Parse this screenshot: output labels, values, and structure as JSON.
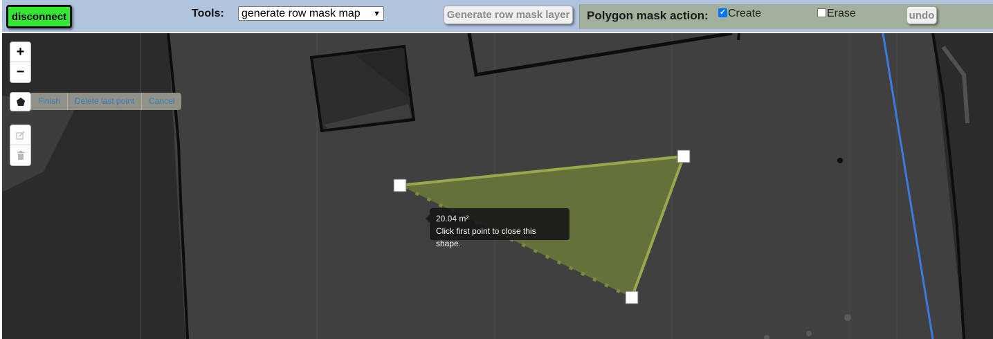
{
  "toolbar": {
    "disconnect_label": "disconnect",
    "tools_label": "Tools:",
    "tools_selected": "generate row mask map",
    "generate_button": "Generate row mask layer",
    "polygon_action_label": "Polygon mask action:",
    "create_label": "Create",
    "create_checked": true,
    "erase_label": "Erase",
    "erase_checked": false,
    "undo_label": "undo"
  },
  "map_controls": {
    "zoom_in": "+",
    "zoom_out": "−",
    "draw_actions": [
      "Finish",
      "Delete last point",
      "Cancel"
    ]
  },
  "drawing": {
    "area": "20.04 m²",
    "hint": "Click first point to close this shape."
  },
  "icons": [
    "polygon-icon",
    "edit-icon",
    "trash-icon",
    "chevron-down-icon"
  ],
  "colors": {
    "disconnect_bg": "#32e632",
    "toolbar_bg": "#b0c4de",
    "polygon_action_bg": "#a3b09c",
    "polygon_fill": "#6b7a3a",
    "polygon_stroke": "#98a84a",
    "path_line": "#3a7be0",
    "map_bg": "#404040"
  }
}
